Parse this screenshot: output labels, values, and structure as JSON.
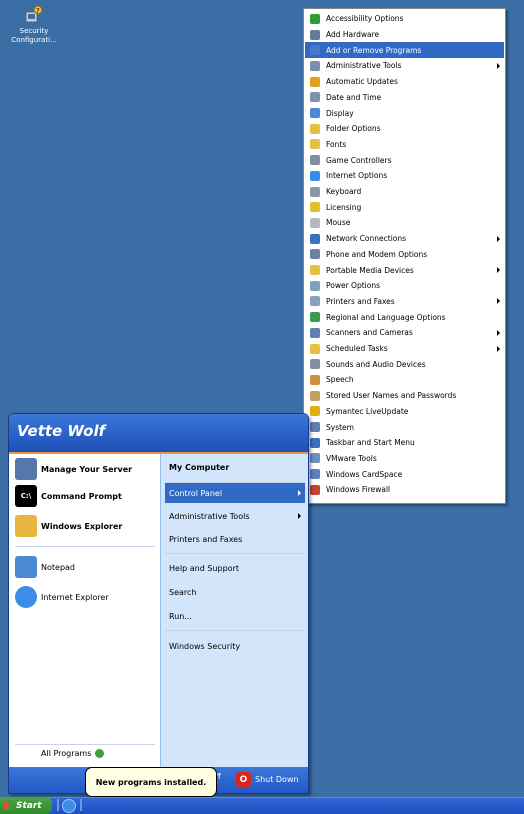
{
  "desktop": {
    "icon_label_line1": "Security",
    "icon_label_line2": "Configurati...",
    "icon_name": "security-config-icon"
  },
  "start_menu": {
    "user_name": "Vette Wolf",
    "left_pinned": [
      {
        "label": "Manage Your Server",
        "icon": "server-icon",
        "color": "#5577aa"
      },
      {
        "label": "Command Prompt",
        "icon": "cmd-icon",
        "color": "#000000"
      },
      {
        "label": "Windows Explorer",
        "icon": "explorer-icon",
        "color": "#e6b640"
      }
    ],
    "left_recent": [
      {
        "label": "Notepad",
        "icon": "notepad-icon",
        "color": "#4a8ad0"
      },
      {
        "label": "Internet Explorer",
        "icon": "ie-icon",
        "color": "#3b8de8"
      }
    ],
    "all_programs": "All Programs",
    "right_items": [
      {
        "label": "My Computer",
        "icon": "my-computer-icon",
        "color": "#5b8bd9",
        "bold": true
      },
      {
        "label": "Control Panel",
        "icon": "control-panel-icon",
        "color": "#6c9fe0",
        "highlight": true,
        "submenu": true
      },
      {
        "label": "Administrative Tools",
        "icon": "admin-tools-icon",
        "color": "#7b8fb0",
        "submenu": true
      },
      {
        "label": "Printers and Faxes",
        "icon": "printer-icon",
        "color": "#8aa0c0"
      },
      {
        "label": "Help and Support",
        "icon": "help-icon",
        "color": "#2f6fd8"
      },
      {
        "label": "Search",
        "icon": "search-icon",
        "color": "#6a8fc8"
      },
      {
        "label": "Run...",
        "icon": "run-icon",
        "color": "#7c9fd0"
      },
      {
        "label": "Windows Security",
        "icon": "windows-security-icon",
        "color": "#e2b640"
      }
    ],
    "log_off": "Off",
    "shut_down": "Shut Down"
  },
  "control_panel_menu": [
    {
      "label": "Accessibility Options",
      "icon": "accessibility-icon",
      "color": "#2f9b3a"
    },
    {
      "label": "Add Hardware",
      "icon": "add-hardware-icon",
      "color": "#607d9b"
    },
    {
      "label": "Add or Remove Programs",
      "icon": "add-remove-programs-icon",
      "color": "#4a78c8",
      "highlight": true
    },
    {
      "label": "Administrative Tools",
      "icon": "admin-tools-icon",
      "color": "#7b8fb0",
      "submenu": true
    },
    {
      "label": "Automatic Updates",
      "icon": "auto-updates-icon",
      "color": "#e0a020"
    },
    {
      "label": "Date and Time",
      "icon": "date-time-icon",
      "color": "#8090b0"
    },
    {
      "label": "Display",
      "icon": "display-icon",
      "color": "#4a88d8"
    },
    {
      "label": "Folder Options",
      "icon": "folder-options-icon",
      "color": "#e6c040"
    },
    {
      "label": "Fonts",
      "icon": "fonts-icon",
      "color": "#e6c040"
    },
    {
      "label": "Game Controllers",
      "icon": "game-controllers-icon",
      "color": "#8090a0"
    },
    {
      "label": "Internet Options",
      "icon": "internet-options-icon",
      "color": "#3b8de8"
    },
    {
      "label": "Keyboard",
      "icon": "keyboard-icon",
      "color": "#8a98a8"
    },
    {
      "label": "Licensing",
      "icon": "licensing-icon",
      "color": "#e0c030"
    },
    {
      "label": "Mouse",
      "icon": "mouse-icon",
      "color": "#b0b8c0"
    },
    {
      "label": "Network Connections",
      "icon": "network-icon",
      "color": "#3a70c0",
      "submenu": true
    },
    {
      "label": "Phone and Modem Options",
      "icon": "phone-modem-icon",
      "color": "#7080a0"
    },
    {
      "label": "Portable Media Devices",
      "icon": "portable-media-icon",
      "color": "#e6c040",
      "submenu": true
    },
    {
      "label": "Power Options",
      "icon": "power-options-icon",
      "color": "#80a0c0"
    },
    {
      "label": "Printers and Faxes",
      "icon": "printer-icon",
      "color": "#8aa0c0",
      "submenu": true
    },
    {
      "label": "Regional and Language Options",
      "icon": "regional-icon",
      "color": "#3a9a50"
    },
    {
      "label": "Scanners and Cameras",
      "icon": "scanner-icon",
      "color": "#6080b0",
      "submenu": true
    },
    {
      "label": "Scheduled Tasks",
      "icon": "scheduled-tasks-icon",
      "color": "#e6c040",
      "submenu": true
    },
    {
      "label": "Sounds and Audio Devices",
      "icon": "sounds-icon",
      "color": "#8090a0"
    },
    {
      "label": "Speech",
      "icon": "speech-icon",
      "color": "#d09040"
    },
    {
      "label": "Stored User Names and Passwords",
      "icon": "stored-users-icon",
      "color": "#c0a060"
    },
    {
      "label": "Symantec LiveUpdate",
      "icon": "symantec-icon",
      "color": "#e0b010"
    },
    {
      "label": "System",
      "icon": "system-icon",
      "color": "#6080b0"
    },
    {
      "label": "Taskbar and Start Menu",
      "icon": "taskbar-icon",
      "color": "#3a70c0"
    },
    {
      "label": "VMware Tools",
      "icon": "vmware-icon",
      "color": "#6a90c0"
    },
    {
      "label": "Windows CardSpace",
      "icon": "cardspace-icon",
      "color": "#5a80c0"
    },
    {
      "label": "Windows Firewall",
      "icon": "firewall-icon",
      "color": "#c84030"
    }
  ],
  "tooltip": "New programs installed.",
  "taskbar": {
    "start_label": "Start"
  }
}
